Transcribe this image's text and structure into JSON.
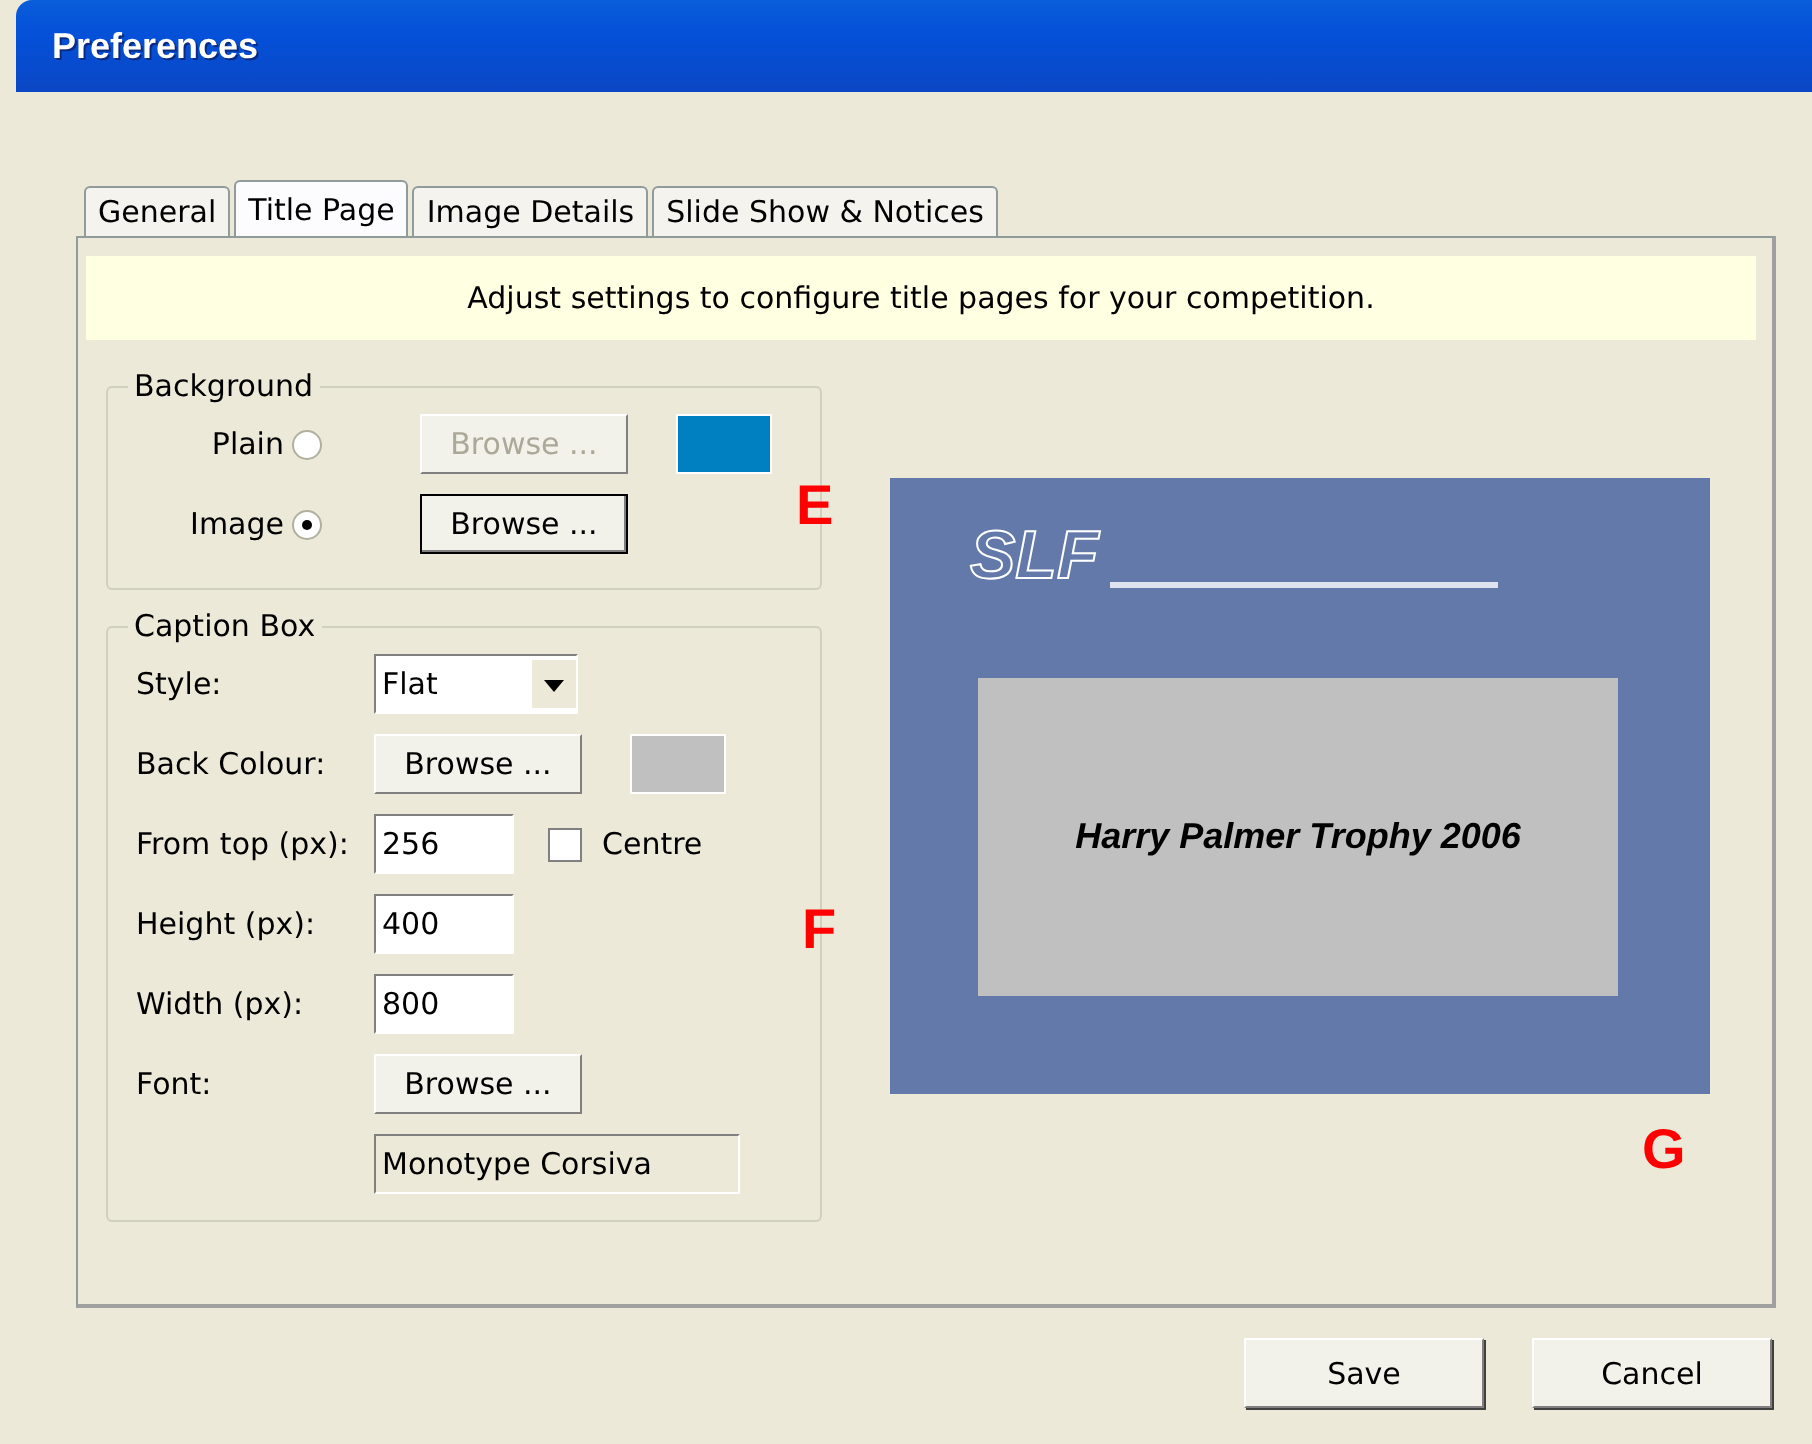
{
  "window": {
    "title": "Preferences"
  },
  "tabs": [
    {
      "label": "General",
      "selected": false
    },
    {
      "label": "Title Page",
      "selected": true
    },
    {
      "label": "Image Details",
      "selected": false
    },
    {
      "label": "Slide Show & Notices",
      "selected": false
    }
  ],
  "banner": "Adjust settings to configure title pages for your competition.",
  "background": {
    "title": "Background",
    "color": "#0080c0",
    "options": [
      {
        "label": "Plain",
        "selected": false,
        "button": {
          "label": "Browse ...",
          "disabled": true
        }
      },
      {
        "label": "Image",
        "selected": true,
        "button": {
          "label": "Browse ...",
          "disabled": false
        }
      }
    ]
  },
  "caption_box": {
    "title": "Caption Box",
    "style": {
      "label": "Style:",
      "value": "Flat"
    },
    "back_colour": {
      "label": "Back Colour:",
      "button": "Browse ...",
      "color": "#c0c0c0"
    },
    "from_top": {
      "label": "From top (px):",
      "value": "256"
    },
    "centre": {
      "label": "Centre",
      "checked": false
    },
    "height": {
      "label": "Height (px):",
      "value": "400"
    },
    "width": {
      "label": "Width (px):",
      "value": "800"
    },
    "font": {
      "label": "Font:",
      "button": "Browse ...",
      "value": "Monotype Corsiva"
    }
  },
  "preview": {
    "logo": "SLF",
    "caption": "Harry Palmer Trophy 2006"
  },
  "annotations": [
    "E",
    "F",
    "G"
  ],
  "buttons": [
    "Save",
    "Cancel"
  ]
}
